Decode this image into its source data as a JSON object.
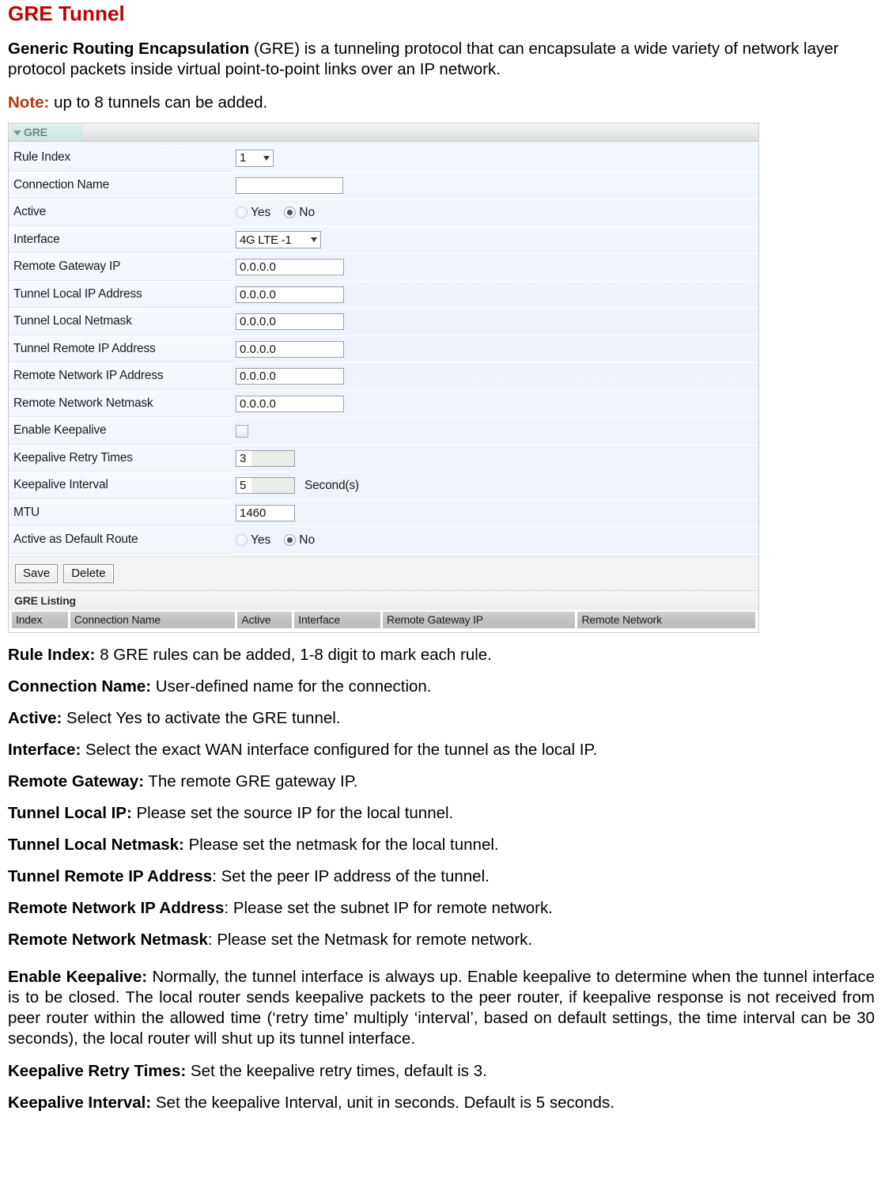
{
  "doc": {
    "title": "GRE Tunnel",
    "intro_bold": "Generic Routing Encapsulation",
    "intro_rest": " (GRE) is a tunneling protocol that can encapsulate a wide variety of network layer protocol packets inside virtual point-to-point links over an IP network.",
    "note_label": "Note:",
    "note_text": " up to 8 tunnels can be added.",
    "title_color": "#c00000",
    "note_color": "#b23a10"
  },
  "panel": {
    "title": "GRE",
    "collapse_icon": "triangle-down-icon",
    "rows": [
      {
        "label": "Rule Index",
        "control": "select",
        "value": "1"
      },
      {
        "label": "Connection Name",
        "control": "text",
        "value": ""
      },
      {
        "label": "Active",
        "control": "radio",
        "value": "No"
      },
      {
        "label": "Interface",
        "control": "select",
        "value": "4G LTE -1"
      },
      {
        "label": "Remote Gateway IP",
        "control": "text",
        "value": "0.0.0.0"
      },
      {
        "label": "Tunnel Local IP Address",
        "control": "text",
        "value": "0.0.0.0"
      },
      {
        "label": "Tunnel Local Netmask",
        "control": "text",
        "value": "0.0.0.0"
      },
      {
        "label": "Tunnel Remote IP Address",
        "control": "text",
        "value": "0.0.0.0"
      },
      {
        "label": "Remote Network IP Address",
        "control": "text",
        "value": "0.0.0.0"
      },
      {
        "label": "Remote Network Netmask",
        "control": "text",
        "value": "0.0.0.0"
      },
      {
        "label": "Enable Keepalive",
        "control": "checkbox",
        "value": "unchecked"
      },
      {
        "label": "Keepalive Retry Times",
        "control": "text",
        "value": "3"
      },
      {
        "label": "Keepalive Interval",
        "control": "text",
        "value": "5",
        "unit": "Second(s)"
      },
      {
        "label": "MTU",
        "control": "text",
        "value": "1460"
      },
      {
        "label": "Active as Default Route",
        "control": "radio",
        "value": "No"
      }
    ],
    "radio_yes": "Yes",
    "radio_no": "No",
    "buttons": {
      "save": "Save",
      "delete": "Delete"
    },
    "listing": {
      "title": "GRE Listing",
      "columns": [
        "Index",
        "Connection Name",
        "Active",
        "Interface",
        "Remote Gateway IP",
        "Remote Network"
      ],
      "rows": []
    }
  },
  "definitions": [
    {
      "term": "Rule Index:",
      "desc": " 8 GRE rules can be added, 1-8 digit to mark each rule."
    },
    {
      "term": "Connection Name:",
      "desc": " User-defined name for the connection."
    },
    {
      "term": "Active:",
      "desc": " Select Yes to activate the GRE tunnel."
    },
    {
      "term": "Interface:",
      "desc": " Select the exact WAN interface configured for the tunnel as the local IP."
    },
    {
      "term": "Remote Gateway:",
      "desc": " The remote GRE gateway IP."
    },
    {
      "term": "Tunnel Local IP:",
      "desc": " Please set the source IP for the local tunnel."
    },
    {
      "term": "Tunnel Local Netmask:",
      "desc": " Please set the netmask for the local tunnel."
    },
    {
      "term": "Tunnel Remote IP Address",
      "desc": ": Set the peer IP address of the tunnel."
    },
    {
      "term": "Remote Network IP Address",
      "desc": ": Please set the subnet IP for remote network."
    },
    {
      "term": "Remote Network Netmask",
      "desc": ": Please set the Netmask for remote network."
    }
  ],
  "keepalive": {
    "term": "Enable Keepalive:",
    "desc": " Normally, the tunnel interface is always up. Enable keepalive to determine when the tunnel interface is to be closed. The local router sends keepalive packets to the peer router, if keepalive response is not received from peer router within the allowed time (‘retry time’ multiply ‘interval’, based on default settings, the time interval can be 30 seconds), the local router will shut up its tunnel interface."
  },
  "tail_definitions": [
    {
      "term": "Keepalive Retry Times:",
      "desc": " Set the keepalive retry times, default is 3."
    },
    {
      "term": "Keepalive Interval:",
      "desc": " Set the keepalive Interval, unit in seconds. Default is 5 seconds."
    }
  ]
}
